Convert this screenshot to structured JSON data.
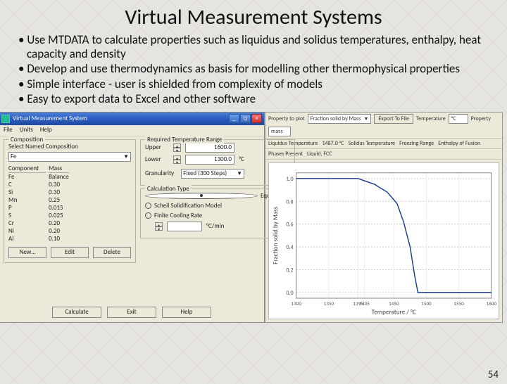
{
  "title": "Virtual Measurement Systems",
  "bullets": [
    "Use MTDATA to calculate properties such as liquidus and solidus temperatures, enthalpy, heat capacity and density",
    "Develop and use thermodynamics as basis for modelling other thermophysical properties",
    "Simple interface - user is shielded from complexity of models",
    "Easy to export data to Excel and other software"
  ],
  "page_number": "54",
  "vms": {
    "window_title": "Virtual Measurement System",
    "menu": [
      "File",
      "Units",
      "Help"
    ],
    "composition": {
      "group_label": "Composition",
      "select_label": "Select Named Composition",
      "select_value": "Fe",
      "table_headers": [
        "Component",
        "Mass"
      ],
      "table": [
        {
          "c": "Fe",
          "m": "Balance"
        },
        {
          "c": "C",
          "m": "0.30"
        },
        {
          "c": "Si",
          "m": "0.30"
        },
        {
          "c": "Mn",
          "m": "0.25"
        },
        {
          "c": "P",
          "m": "0.015"
        },
        {
          "c": "S",
          "m": "0.025"
        },
        {
          "c": "Cr",
          "m": "0.20"
        },
        {
          "c": "Ni",
          "m": "0.20"
        },
        {
          "c": "Al",
          "m": "0.10"
        }
      ],
      "buttons": {
        "new": "New…",
        "edit": "Edit",
        "delete": "Delete"
      }
    },
    "temp": {
      "group_label": "Required Temperature Range",
      "upper_label": "Upper",
      "upper_value": "1600.0",
      "lower_label": "Lower",
      "lower_value": "1300.0",
      "unit": "°C",
      "gran_label": "Granularity",
      "gran_value": "Fixed (300 Steps)"
    },
    "calc": {
      "group_label": "Calculation Type",
      "opt1": "Equilibrium",
      "opt2": "Scheil Solidification Model",
      "opt3": "Finite Cooling Rate",
      "rate_label": "",
      "rate_value": "",
      "rate_unit": "°C/min"
    },
    "actions": {
      "calc": "Calculate",
      "exit": "Exit",
      "help": "Help"
    }
  },
  "chart": {
    "toprow": {
      "prop_label": "Property to plot",
      "prop_value": "Fraction solid by Mass",
      "export": "Export To File",
      "temp_label": "Temperature",
      "temp_unit": "°C",
      "prop2_label": "Property",
      "prop2_unit": "mass"
    },
    "info": {
      "liquidus_label": "Liquidus Temperature",
      "liquidus_value": "1487.0 °C",
      "solidus_label": "Solidus Temperature",
      "solidus_value": "—",
      "freezing_label": "Freezing Range",
      "freezing_value": "—",
      "enthalpy_label": "Enthalpy of Fusion",
      "enthalpy_value": "—"
    },
    "ylabel": "Fraction solid by Mass",
    "xlabel": "Temperature / °C",
    "phases_label": "Phases Present",
    "phases_value": "Liquid, FCC"
  },
  "chart_data": {
    "type": "line",
    "xlabel": "Temperature / °C",
    "ylabel": "Fraction solid by Mass",
    "xlim": [
      1300,
      1600
    ],
    "ylim": [
      -0.05,
      1.05
    ],
    "x_ticks": [
      1300,
      1350,
      1395,
      1405,
      1450,
      1500,
      1550,
      1600
    ],
    "y_ticks": [
      0.0,
      0.2,
      0.4,
      0.6,
      0.8,
      1.0
    ],
    "x": [
      1300,
      1350,
      1395,
      1405,
      1420,
      1440,
      1455,
      1465,
      1475,
      1482,
      1487,
      1490,
      1600
    ],
    "y": [
      1.0,
      1.0,
      1.0,
      0.98,
      0.95,
      0.88,
      0.78,
      0.62,
      0.4,
      0.15,
      0.0,
      0.0,
      0.0
    ]
  }
}
